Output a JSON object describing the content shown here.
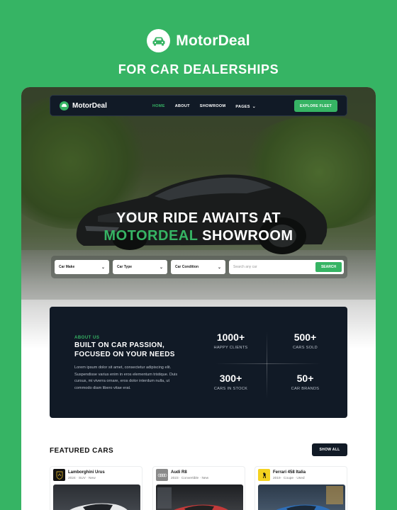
{
  "brand": {
    "name": "MotorDeal",
    "tagline": "FOR CAR DEALERSHIPS",
    "icon": "car-icon"
  },
  "colors": {
    "accent": "#36b464",
    "navy": "#111a26"
  },
  "nav": {
    "logo_text": "MotorDeal",
    "links": [
      "HOME",
      "ABOUT",
      "SHOWROOM",
      "PAGES"
    ],
    "active": "HOME",
    "cta": "EXPLORE FLEET"
  },
  "hero": {
    "line1": "YOUR RIDE AWAITS AT",
    "line2_accent": "MOTORDEAL",
    "line2_rest": " SHOWROOM"
  },
  "search": {
    "car_make": "Car Make",
    "car_type": "Car Type",
    "car_condition": "Car Condition",
    "placeholder": "Search any car",
    "button": "SEARCH"
  },
  "about": {
    "tag": "ABOUT US",
    "heading_line1": "BUILT ON CAR PASSION,",
    "heading_line2": "FOCUSED ON YOUR NEEDS",
    "body": "Lorem ipsum dolor sit amet, consectetur adipiscing elit. Suspendisse varius enim in eros elementum tristique. Duis cursus, mi viverra ornare, eros dolor interdum nulla, ut commodo diam libero vitae erat.",
    "stats": [
      {
        "value": "1000+",
        "label": "HAPPY CLIENTS"
      },
      {
        "value": "500+",
        "label": "CARS SOLD"
      },
      {
        "value": "300+",
        "label": "CARS IN STOCK"
      },
      {
        "value": "50+",
        "label": "CAR BRANDS"
      }
    ]
  },
  "featured": {
    "title": "FEATURED CARS",
    "show_all": "SHOW ALL",
    "cars": [
      {
        "name": "Lamborghini Urus",
        "meta": "2024 · SUV · New",
        "logo_bg": "#111111"
      },
      {
        "name": "Audi R8",
        "meta": "2023 · Convertible · New",
        "logo_bg": "#8a8a8a"
      },
      {
        "name": "Ferrari 458 Italia",
        "meta": "2019 · Coupe · Used",
        "logo_bg": "#f4d21f"
      }
    ]
  }
}
